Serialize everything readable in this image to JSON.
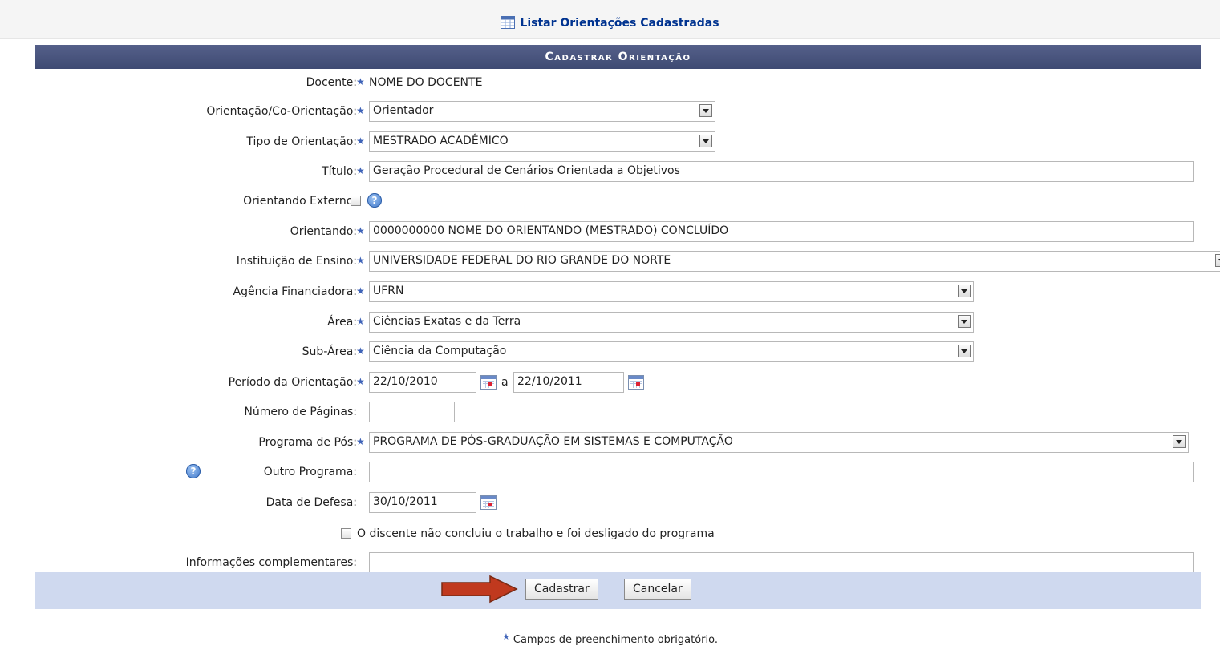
{
  "top_link": {
    "label": "Listar Orientações Cadastradas"
  },
  "form": {
    "caption": "Cadastrar Orientação",
    "docente": {
      "label": "Docente:",
      "value": "NOME DO DOCENTE"
    },
    "orientacao": {
      "label": "Orientação/Co-Orientação:",
      "value": "Orientador"
    },
    "tipo": {
      "label": "Tipo de Orientação:",
      "value": "MESTRADO ACADÊMICO"
    },
    "titulo": {
      "label": "Título:",
      "value": "Geração Procedural de Cenários Orientada a Objetivos"
    },
    "externo": {
      "label": "Orientando Externo:"
    },
    "orientando": {
      "label": "Orientando:",
      "value": "0000000000 NOME DO ORIENTANDO (MESTRADO) CONCLUÍDO"
    },
    "instituicao": {
      "label": "Instituição de Ensino:",
      "value": "UNIVERSIDADE FEDERAL DO RIO GRANDE DO NORTE"
    },
    "agencia": {
      "label": "Agência Financiadora:",
      "value": "UFRN"
    },
    "area": {
      "label": "Área:",
      "value": "Ciências Exatas e da Terra"
    },
    "subarea": {
      "label": "Sub-Área:",
      "value": "Ciência da Computação"
    },
    "periodo": {
      "label": "Período da Orientação:",
      "start": "22/10/2010",
      "sep": "a",
      "end": "22/10/2011"
    },
    "paginas": {
      "label": "Número de Páginas:",
      "value": ""
    },
    "programa": {
      "label": "Programa de Pós:",
      "value": "PROGRAMA DE PÓS-GRADUAÇÃO EM SISTEMAS E COMPUTAÇÃO"
    },
    "outro_programa": {
      "label": "Outro Programa:",
      "value": ""
    },
    "defesa": {
      "label": "Data de Defesa:",
      "value": "30/10/2011"
    },
    "desligado": {
      "label": "O discente não concluiu o trabalho e foi desligado do programa"
    },
    "info": {
      "label": "Informações complementares:",
      "value": ""
    }
  },
  "buttons": {
    "submit": "Cadastrar",
    "cancel": "Cancelar"
  },
  "note": "Campos de preenchimento obrigatório.",
  "colors": {
    "header": "#3e4a72",
    "footer": "#cfd9ef",
    "arrow": "#c0391e",
    "required_star": "#3f63b8"
  }
}
